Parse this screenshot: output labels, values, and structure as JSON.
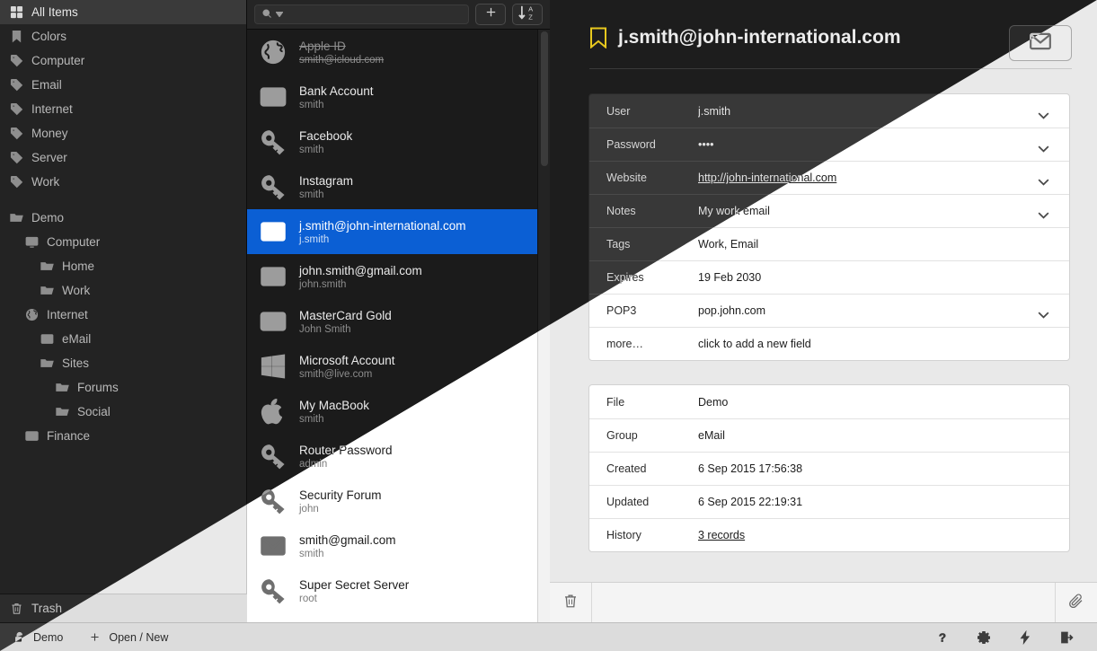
{
  "sidebar": {
    "tags": [
      {
        "label": "All Items",
        "icon": "grid-icon",
        "active": true
      },
      {
        "label": "Colors",
        "icon": "bookmark-icon",
        "active": false
      },
      {
        "label": "Computer",
        "icon": "tag-icon",
        "active": false
      },
      {
        "label": "Email",
        "icon": "tag-icon",
        "active": false
      },
      {
        "label": "Internet",
        "icon": "tag-icon",
        "active": false
      },
      {
        "label": "Money",
        "icon": "tag-icon",
        "active": false
      },
      {
        "label": "Server",
        "icon": "tag-icon",
        "active": false
      },
      {
        "label": "Work",
        "icon": "tag-icon",
        "active": false
      }
    ],
    "tree": [
      {
        "label": "Demo",
        "icon": "folder-icon",
        "indent": 0
      },
      {
        "label": "Computer",
        "icon": "monitor-icon",
        "indent": 1
      },
      {
        "label": "Home",
        "icon": "folder-icon",
        "indent": 2
      },
      {
        "label": "Work",
        "icon": "folder-icon",
        "indent": 2
      },
      {
        "label": "Internet",
        "icon": "globe-icon",
        "indent": 1
      },
      {
        "label": "eMail",
        "icon": "envelope-icon",
        "indent": 2
      },
      {
        "label": "Sites",
        "icon": "folder-icon",
        "indent": 2
      },
      {
        "label": "Forums",
        "icon": "folder-icon",
        "indent": 3
      },
      {
        "label": "Social",
        "icon": "folder-icon",
        "indent": 3
      },
      {
        "label": "Finance",
        "icon": "card-icon",
        "indent": 1
      }
    ],
    "trash": {
      "label": "Trash",
      "icon": "trash-icon"
    }
  },
  "list": {
    "search_placeholder": "",
    "search_value": "",
    "add_label": "+",
    "sort_label": "sort-az",
    "items": [
      {
        "title": "Apple ID",
        "subtitle": "smith@icloud.com",
        "icon": "globe-icon",
        "selected": false,
        "struck": true
      },
      {
        "title": "Bank Account",
        "subtitle": "smith",
        "icon": "card-icon",
        "selected": false,
        "struck": false
      },
      {
        "title": "Facebook",
        "subtitle": "smith",
        "icon": "key-icon",
        "selected": false,
        "struck": false
      },
      {
        "title": "Instagram",
        "subtitle": "smith",
        "icon": "key-icon",
        "selected": false,
        "struck": false
      },
      {
        "title": "j.smith@john-international.com",
        "subtitle": "j.smith",
        "icon": "envelope-icon",
        "selected": true,
        "struck": false
      },
      {
        "title": "john.smith@gmail.com",
        "subtitle": "john.smith",
        "icon": "envelope-icon",
        "selected": false,
        "struck": false
      },
      {
        "title": "MasterCard Gold",
        "subtitle": "John Smith",
        "icon": "card-icon",
        "selected": false,
        "struck": false
      },
      {
        "title": "Microsoft Account",
        "subtitle": "smith@live.com",
        "icon": "windows-icon",
        "selected": false,
        "struck": false
      },
      {
        "title": "My MacBook",
        "subtitle": "smith",
        "icon": "apple-icon",
        "selected": false,
        "struck": false
      },
      {
        "title": "Router Password",
        "subtitle": "admin",
        "icon": "key-icon",
        "selected": false,
        "struck": false
      },
      {
        "title": "Security Forum",
        "subtitle": "john",
        "icon": "key-icon",
        "selected": false,
        "struck": false
      },
      {
        "title": "smith@gmail.com",
        "subtitle": "smith",
        "icon": "envelope-icon",
        "selected": false,
        "struck": false
      },
      {
        "title": "Super Secret Server",
        "subtitle": "root",
        "icon": "key-icon",
        "selected": false,
        "struck": false
      }
    ]
  },
  "detail": {
    "title": "j.smith@john-international.com",
    "bookmark_color": "#e8c81e",
    "mail_button": "envelope-icon",
    "fields": [
      {
        "key": "User",
        "value": "j.smith",
        "chevron": true,
        "link": false
      },
      {
        "key": "Password",
        "value": "••••",
        "chevron": true,
        "link": false
      },
      {
        "key": "Website",
        "value": "http://john-international.com",
        "chevron": true,
        "link": true
      },
      {
        "key": "Notes",
        "value": "My work email",
        "chevron": true,
        "link": false
      },
      {
        "key": "Tags",
        "value": "Work, Email",
        "chevron": false,
        "link": false
      },
      {
        "key": "Expires",
        "value": "19 Feb 2030",
        "chevron": false,
        "link": false
      },
      {
        "key": "POP3",
        "value": "pop.john.com",
        "chevron": true,
        "link": false
      },
      {
        "key": "more…",
        "value": "click to add a new field",
        "chevron": false,
        "link": false
      }
    ],
    "meta": [
      {
        "key": "File",
        "value": "Demo",
        "link": false
      },
      {
        "key": "Group",
        "value": "eMail",
        "link": false
      },
      {
        "key": "Created",
        "value": "6 Sep 2015 17:56:38",
        "link": false
      },
      {
        "key": "Updated",
        "value": "6 Sep 2015 22:19:31",
        "link": false
      },
      {
        "key": "History",
        "value": "3 records",
        "link": true
      }
    ],
    "footer": {
      "delete": "trash-icon",
      "attach": "paperclip-icon"
    }
  },
  "statusbar": {
    "file": "Demo",
    "file_icon": "unlock-icon",
    "open_new": "Open / New",
    "open_new_icon": "plus-icon",
    "actions": [
      {
        "name": "help-icon",
        "glyph": "?"
      },
      {
        "name": "gear-icon",
        "glyph": "gear"
      },
      {
        "name": "lightning-icon",
        "glyph": "bolt"
      },
      {
        "name": "logout-icon",
        "glyph": "exit"
      }
    ]
  }
}
